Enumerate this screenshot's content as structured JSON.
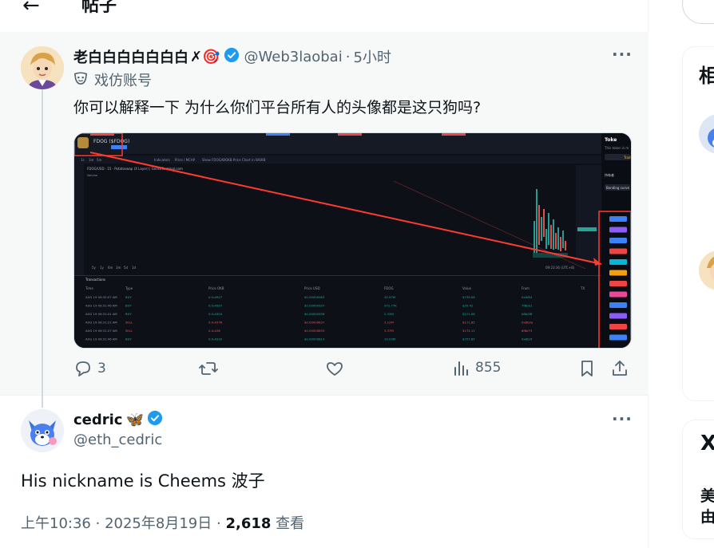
{
  "header": {
    "back_icon": "arrow-left-icon",
    "title": "帖子"
  },
  "tweet": {
    "author_name": "老白白白白白白白",
    "emoji_suffix": "✗🎯",
    "handle": "@Web3laobai",
    "dot": "·",
    "time": "5小时",
    "parody_label": "戏仿账号",
    "text": "你可以解释一下 为什么你们平台所有人的头像都是这只狗吗?",
    "actions": {
      "replies": "3",
      "views": "855"
    },
    "media": {
      "pair": "FDOG ($FDOG)",
      "toolbar": [
        "1s",
        "1m",
        "5m",
        "Indicators",
        "Price / MCAP",
        "Show FDOG/WOKB Price Chart in WOKB"
      ],
      "chart_title": "FDOG/USD · 15 · Potatoswap (X Layer) | GeckoTerminal.com",
      "volume_label": "Volume",
      "ranges": [
        "5y",
        "1y",
        "6m",
        "3m",
        "5d",
        "1d"
      ],
      "clock": "09:23:36 (UTC+8)",
      "transactions_tab": "Transactions",
      "columns": [
        "Time",
        "Type",
        "Price OKB",
        "Price USD",
        "FDOG",
        "Value",
        "From",
        "TX"
      ],
      "rows": [
        [
          "AUG 19",
          "09:32:07 AM",
          "BUY",
          "0.0₀4927",
          "$0.00000963",
          "42.97M",
          "$739.06",
          "0x0f84"
        ],
        [
          "AUG 19",
          "09:31:46 AM",
          "BUY",
          "0.0₀4997",
          "$0.00000937",
          "372.77K",
          "$30.42",
          "7f8bb1"
        ],
        [
          "AUG 19",
          "09:31:41 AM",
          "BUY",
          "0.0₀4304",
          "$0.00000936",
          "2.33M",
          "$121.08",
          "b8b2f8"
        ],
        [
          "AUG 19",
          "09:31:22 AM",
          "SELL",
          "0.0₀4376",
          "$0.00000837",
          "2.12M",
          "$111.85",
          "0x8b2a"
        ],
        [
          "AUG 19",
          "09:31:27 AM",
          "SELL",
          "0.0₀438",
          "$0.00000833",
          "3.37M",
          "$174.11",
          "8f8e73"
        ],
        [
          "AUG 19",
          "09:31:46 AM",
          "BUY",
          "0.0₀4333",
          "$0.00000814",
          "14.03M",
          "$757.85",
          "0x8b2f"
        ]
      ],
      "side_header": "Toke",
      "side_subtitle": "This token is m",
      "side_tag": "Trad",
      "side_section": "持有者",
      "side_curve": "Bonding curve"
    }
  },
  "reply": {
    "author_name": "cedric",
    "butterfly": "🦋",
    "handle": "@eth_cedric",
    "text": "His nickname is Cheems 波子",
    "time": "上午10:36",
    "sep1": "·",
    "date": "2025年8月19日",
    "sep2": "·",
    "views": "2,618",
    "views_label": "查看"
  },
  "sidebar": {
    "top_char": "相",
    "bottom_chars": [
      "X",
      "美",
      "由"
    ]
  }
}
